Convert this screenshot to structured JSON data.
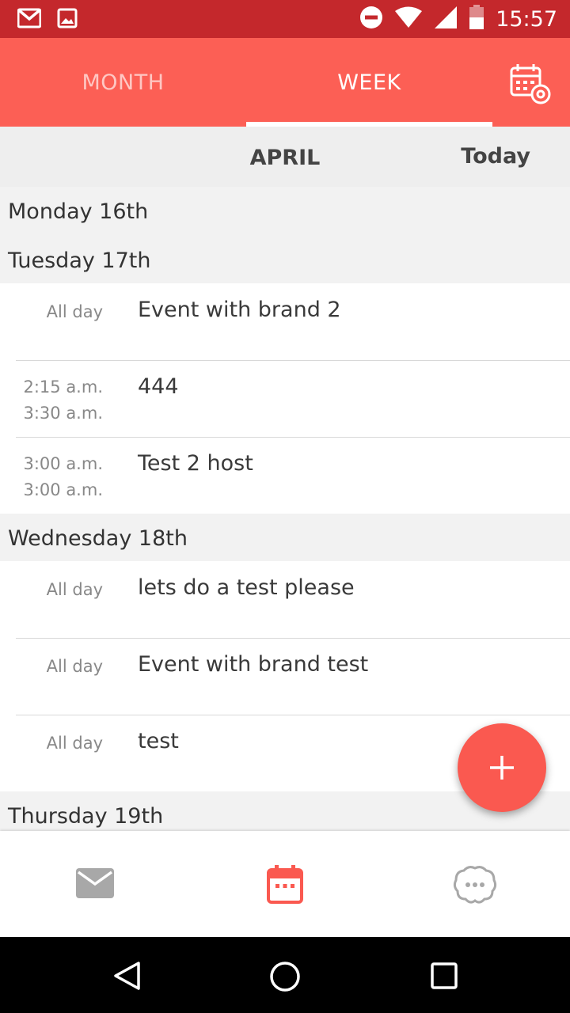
{
  "status_bar": {
    "time": "15:57",
    "icons": [
      "gmail-icon",
      "image-icon",
      "do-not-disturb-icon",
      "wifi-icon",
      "signal-icon",
      "battery-icon"
    ]
  },
  "tabs": {
    "month_label": "MONTH",
    "week_label": "WEEK",
    "active": "WEEK",
    "settings_icon": "calendar-settings-icon"
  },
  "month_header": {
    "month": "APRIL",
    "today_label": "Today"
  },
  "days": [
    {
      "label": "Monday 16th",
      "events": []
    },
    {
      "label": "Tuesday 17th",
      "events": [
        {
          "time_all_day": "All day",
          "title": "Event with brand 2"
        },
        {
          "start": "2:15 a.m.",
          "end": "3:30 a.m.",
          "title": "444"
        },
        {
          "start": "3:00 a.m.",
          "end": "3:00 a.m.",
          "title": "Test 2 host"
        }
      ]
    },
    {
      "label": "Wednesday 18th",
      "events": [
        {
          "time_all_day": "All day",
          "title": "lets do a test please"
        },
        {
          "time_all_day": "All day",
          "title": "Event with brand test"
        },
        {
          "time_all_day": "All day",
          "title": "test"
        }
      ]
    },
    {
      "label": "Thursday 19th",
      "events": []
    }
  ],
  "fab": {
    "icon": "plus-icon"
  },
  "bottom_nav": [
    {
      "icon": "mail-icon",
      "active": false
    },
    {
      "icon": "calendar-icon",
      "active": true
    },
    {
      "icon": "chat-bubble-icon",
      "active": false
    }
  ],
  "colors": {
    "status_bar": "#c4282c",
    "primary": "#fc5f55",
    "fab": "#fa5950",
    "header_bg": "#eeeeee"
  }
}
